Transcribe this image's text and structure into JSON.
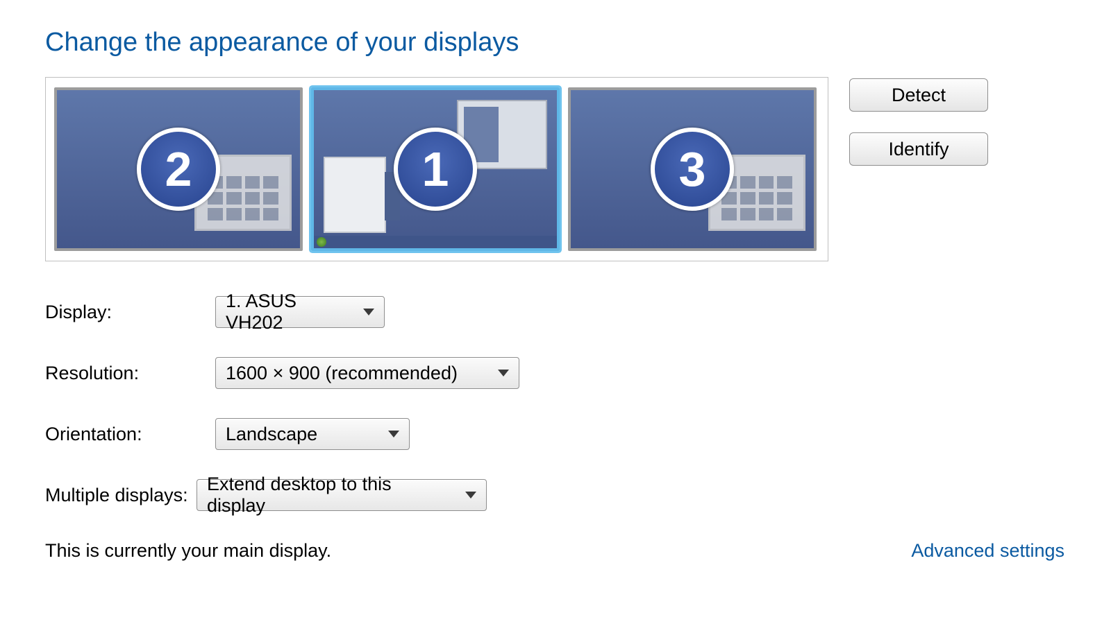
{
  "heading": "Change the appearance of your displays",
  "monitors": {
    "m2": "2",
    "m1": "1",
    "m3": "3"
  },
  "buttons": {
    "detect": "Detect",
    "identify": "Identify"
  },
  "labels": {
    "display": "Display:",
    "resolution": "Resolution:",
    "orientation": "Orientation:",
    "multiple": "Multiple displays:"
  },
  "values": {
    "display": "1. ASUS VH202",
    "resolution": "1600 × 900 (recommended)",
    "orientation": "Landscape",
    "multiple": "Extend desktop to this display"
  },
  "status_text": "This is currently your main display.",
  "advanced_link": "Advanced settings"
}
